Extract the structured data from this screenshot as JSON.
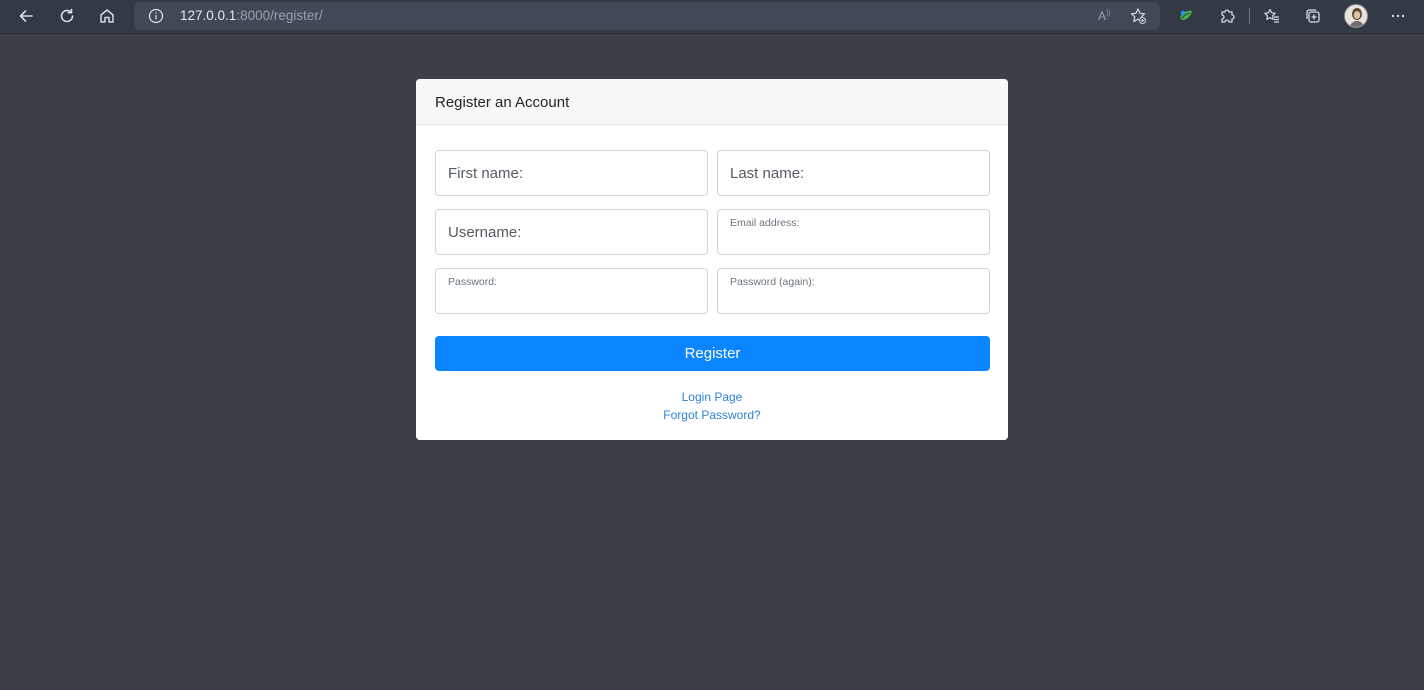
{
  "browser": {
    "url_host": "127.0.0.1",
    "url_rest": ":8000/register/",
    "icons": {
      "back": "back-arrow-icon",
      "reload": "reload-icon",
      "home": "home-icon",
      "site_info": "info-icon",
      "read_aloud": "read-aloud-icon",
      "add_favorite": "add-favorite-icon",
      "extension": "extension-icon",
      "extensions": "puzzle-icon",
      "favorites": "favorites-icon",
      "collections": "collections-icon",
      "more": "more-icon"
    }
  },
  "card": {
    "title": "Register an Account",
    "fields": {
      "first_name": {
        "placeholder": "First name:"
      },
      "last_name": {
        "placeholder": "Last name:"
      },
      "username": {
        "placeholder": "Username:"
      },
      "email": {
        "label": "Email address:"
      },
      "password": {
        "label": "Password:"
      },
      "password_again": {
        "label": "Password (again):"
      }
    },
    "register_label": "Register",
    "login_link": "Login Page",
    "forgot_link": "Forgot Password?"
  },
  "colors": {
    "page_bg": "#3b3f46",
    "toolbar_bg": "#333a45",
    "primary": "#0a84ff",
    "link": "#2f80d8"
  }
}
